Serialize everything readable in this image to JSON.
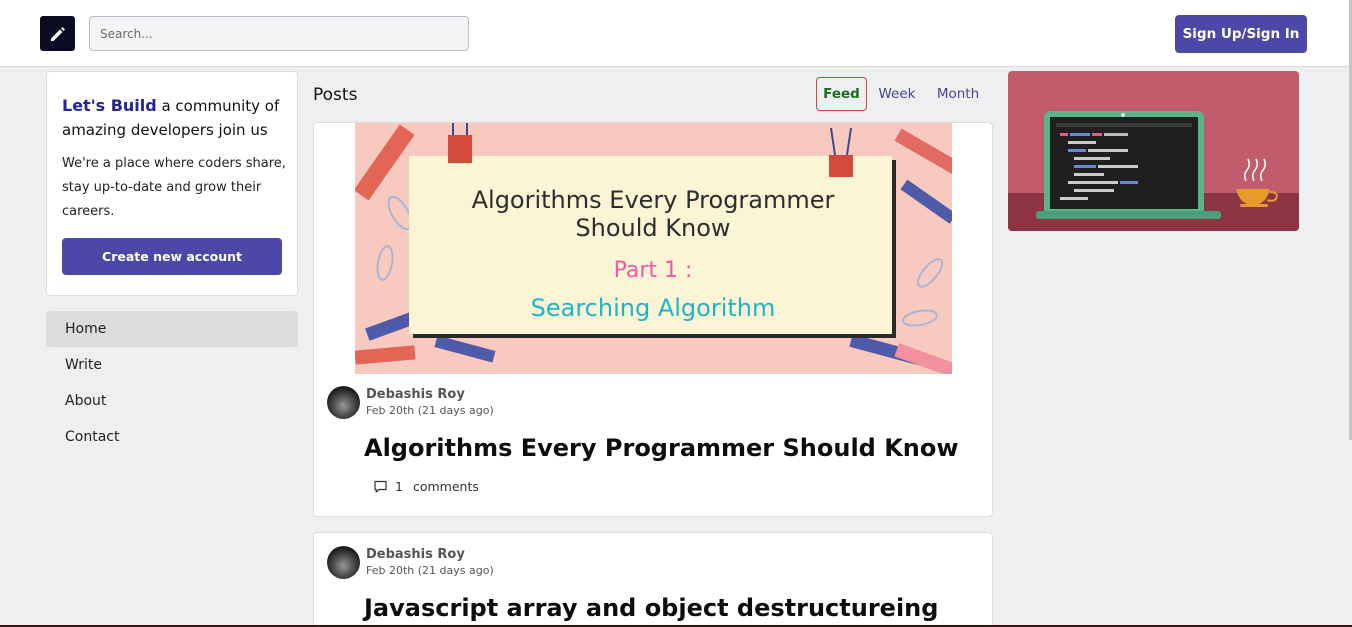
{
  "header": {
    "search_placeholder": "Search...",
    "signin_label": "Sign Up/Sign In",
    "logo_icon": "pencil-icon"
  },
  "intro": {
    "brand": "Let's Build",
    "headline_rest": " a community of amazing developers join us",
    "text": "We're a place where coders share, stay up-to-date and grow their careers.",
    "cta": "Create new account"
  },
  "nav": {
    "items": [
      {
        "label": "Home",
        "active": true
      },
      {
        "label": "Write",
        "active": false
      },
      {
        "label": "About",
        "active": false
      },
      {
        "label": "Contact",
        "active": false
      }
    ]
  },
  "posts": {
    "title": "Posts",
    "tabs": [
      {
        "label": "Feed",
        "active": true
      },
      {
        "label": "Week",
        "active": false
      },
      {
        "label": "Month",
        "active": false
      }
    ],
    "items": [
      {
        "cover": {
          "line1": "Algorithms Every Programmer",
          "line2": "Should Know",
          "part": "Part 1 :",
          "sub": "Searching Algorithm"
        },
        "author": "Debashis Roy",
        "date": "Feb 20th (21 days ago)",
        "title": "Algorithms Every Programmer Should Know",
        "comment_count": "1",
        "comment_label": "comments"
      },
      {
        "author": "Debashis Roy",
        "date": "Feb 20th (21 days ago)",
        "title": "Javascript array and object destructureing"
      }
    ]
  },
  "colors": {
    "accent": "#4b48a8",
    "brand_text": "#23239b",
    "feed_border": "#d24646",
    "feed_text": "#1b6e1b",
    "background": "#eeeff1"
  }
}
